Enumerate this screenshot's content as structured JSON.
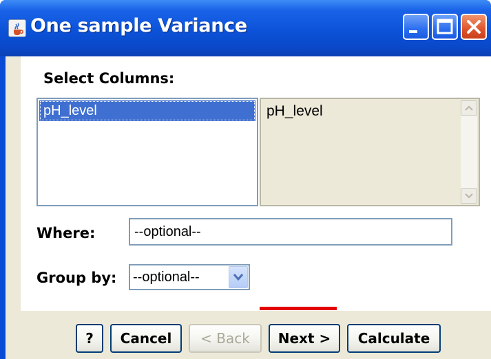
{
  "window": {
    "title": "One sample Variance",
    "icon": "java-cup-icon"
  },
  "form": {
    "select_columns_label": "Select Columns:",
    "available_columns": [
      "pH_level"
    ],
    "selected_columns": [
      "pH_level"
    ],
    "where_label": "Where:",
    "where_placeholder": "--optional--",
    "group_by_label": "Group by:",
    "group_by_value": "--optional--"
  },
  "buttons": {
    "help": "?",
    "cancel": "Cancel",
    "back": "< Back",
    "next": "Next >",
    "calculate": "Calculate"
  },
  "colors": {
    "titlebar": "#0b52d8",
    "selection": "#3f6fd0",
    "highlight_underline": "#e30000"
  }
}
